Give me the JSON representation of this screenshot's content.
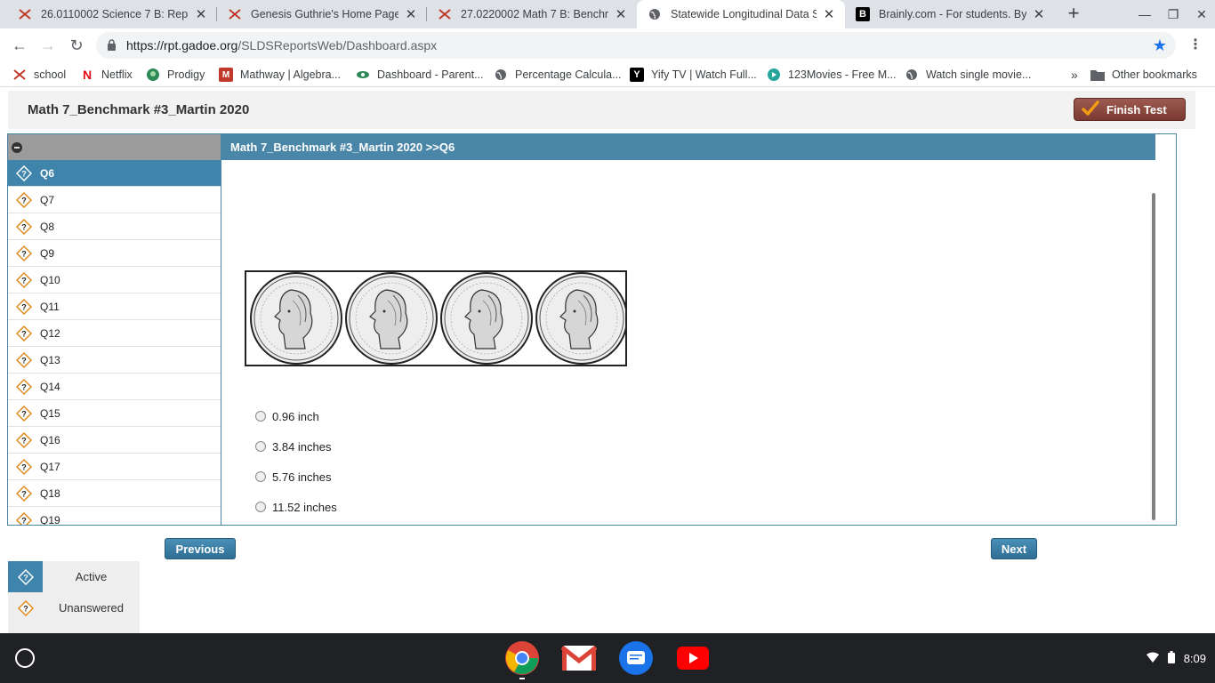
{
  "browser": {
    "tabs": [
      {
        "title": "26.0110002 Science 7 B: Reproduc",
        "active": false
      },
      {
        "title": "Genesis Guthrie's Home Page",
        "active": false
      },
      {
        "title": "27.0220002 Math 7 B: Benchmark",
        "active": false
      },
      {
        "title": "Statewide Longitudinal Data Sy",
        "active": true
      },
      {
        "title": "Brainly.com - For students. By stu",
        "active": false
      }
    ],
    "url_host": "https://rpt.gadoe.org",
    "url_path": "/SLDSReportsWeb/Dashboard.aspx",
    "bookmarks": [
      "school",
      "Netflix",
      "Prodigy",
      "Mathway | Algebra...",
      "Dashboard - Parent...",
      "Percentage Calcula...",
      "Yify TV | Watch Full...",
      "123Movies - Free M...",
      "Watch single movie..."
    ],
    "other_bookmarks": "Other bookmarks"
  },
  "test": {
    "title": "Math 7_Benchmark #3_Martin 2020",
    "finish_label": "Finish Test",
    "breadcrumb": "Math 7_Benchmark #3_Martin 2020 >>Q6",
    "questions": [
      "Q6",
      "Q7",
      "Q8",
      "Q9",
      "Q10",
      "Q11",
      "Q12",
      "Q13",
      "Q14",
      "Q15",
      "Q16",
      "Q17",
      "Q18",
      "Q19"
    ],
    "active_question": "Q6",
    "answers": [
      "0.96 inch",
      "3.84 inches",
      "5.76 inches",
      "11.52 inches"
    ],
    "previous_label": "Previous",
    "next_label": "Next",
    "legend": {
      "active": "Active",
      "unanswered": "Unanswered"
    }
  },
  "system": {
    "time": "8:09",
    "apps": [
      "chrome-icon",
      "gmail-icon",
      "messages-icon",
      "youtube-icon"
    ]
  },
  "colors": {
    "header_blue": "#4a86a8",
    "active_item": "#3f84ab",
    "finish_button": "#8b4a40"
  }
}
